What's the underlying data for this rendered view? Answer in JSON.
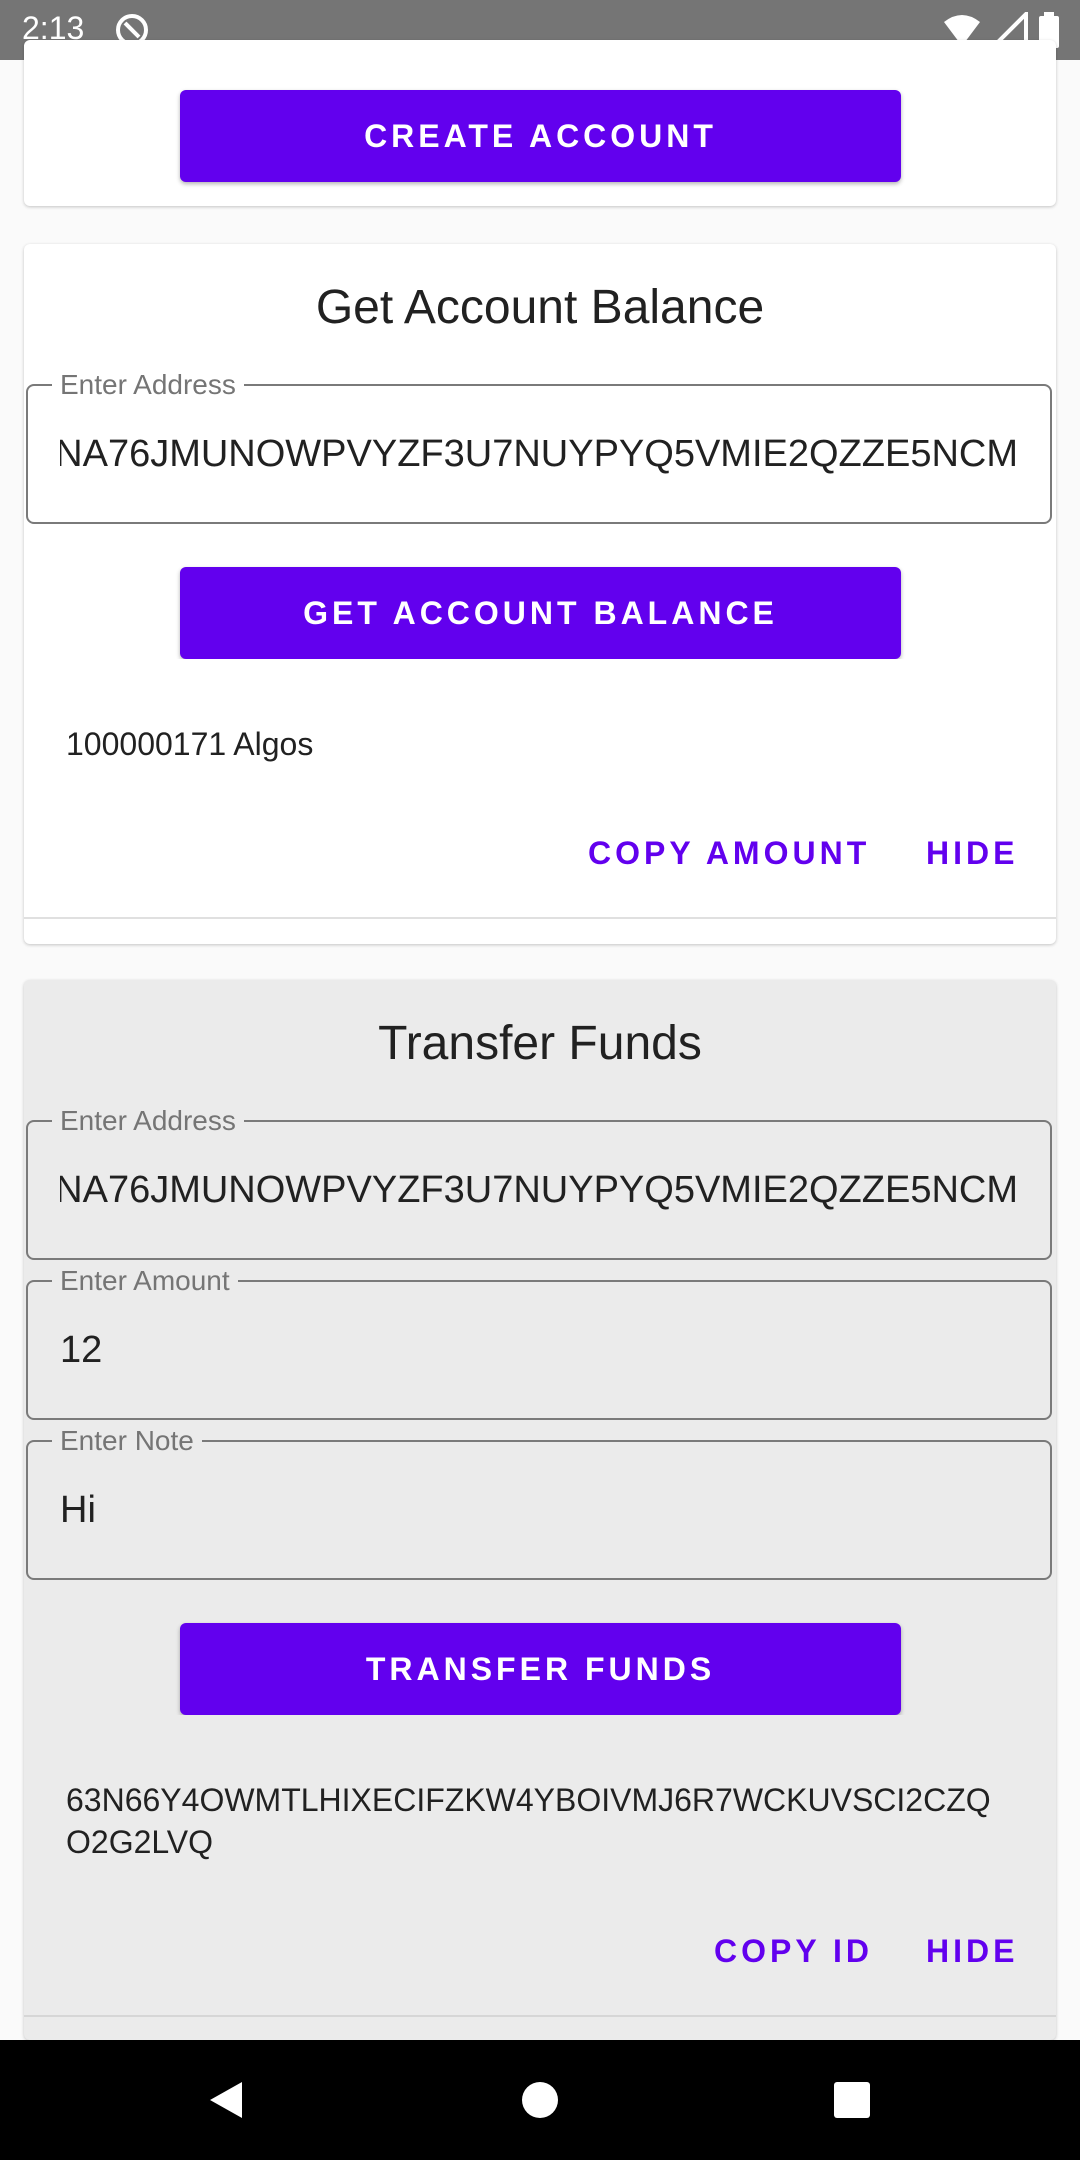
{
  "status_bar": {
    "time": "2:13"
  },
  "create_account": {
    "button_label": "CREATE ACCOUNT"
  },
  "balance": {
    "title": "Get Account Balance",
    "address_label": "Enter Address",
    "address_value": "NA76JMUNOWPVYZF3U7NUYPYQ5VMIE2QZZE5NCM",
    "button_label": "GET ACCOUNT BALANCE",
    "result_text": "100000171 Algos",
    "copy_label": "COPY AMOUNT",
    "hide_label": "HIDE"
  },
  "transfer": {
    "title": "Transfer Funds",
    "address_label": "Enter Address",
    "address_value": "NA76JMUNOWPVYZF3U7NUYPYQ5VMIE2QZZE5NCM",
    "amount_label": "Enter Amount",
    "amount_value": "12",
    "note_label": "Enter Note",
    "note_value": "Hi",
    "button_label": "TRANSFER FUNDS",
    "result_text": "63N66Y4OWMTLHIXECIFZKW4YBOIVMJ6R7WCKUVSCI2CZQO2G2LVQ",
    "copy_label": "COPY ID",
    "hide_label": "HIDE"
  },
  "colors": {
    "accent": "#6200ee",
    "status_bar": "#757575",
    "nav_bar": "#000000"
  }
}
